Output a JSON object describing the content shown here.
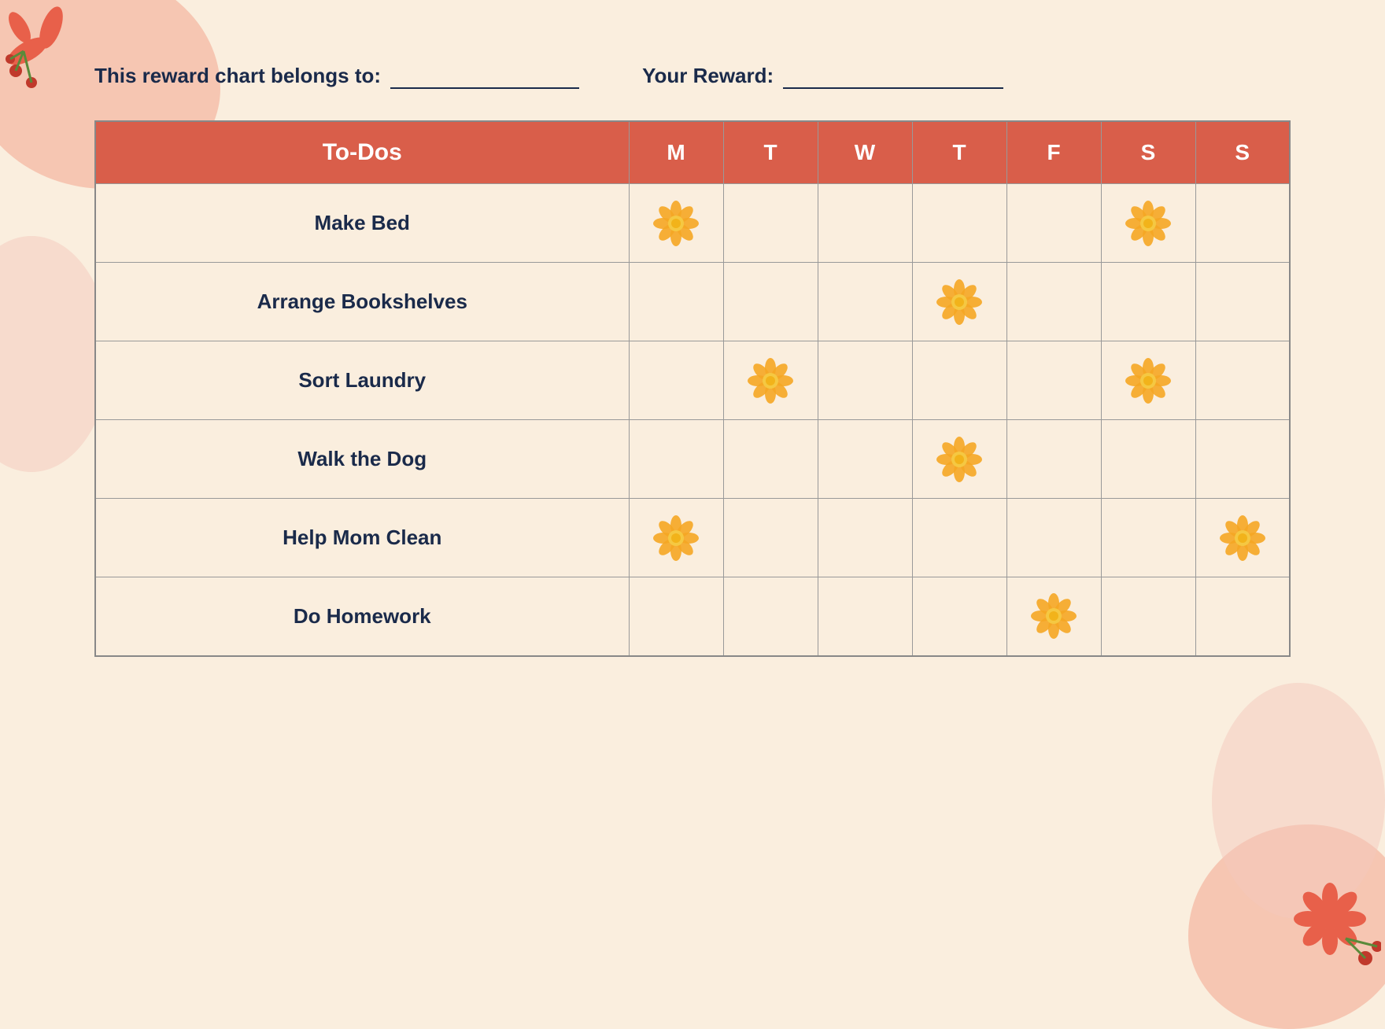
{
  "background_color": "#faeede",
  "header": {
    "belongs_label": "This reward chart belongs to:",
    "reward_label": "Your Reward:"
  },
  "table": {
    "col_header": "To-Dos",
    "days": [
      "M",
      "T",
      "W",
      "T",
      "F",
      "S",
      "S"
    ],
    "rows": [
      {
        "task": "Make Bed",
        "stars": [
          true,
          false,
          false,
          false,
          false,
          true,
          false
        ]
      },
      {
        "task": "Arrange Bookshelves",
        "stars": [
          false,
          false,
          false,
          true,
          false,
          false,
          false
        ]
      },
      {
        "task": "Sort Laundry",
        "stars": [
          false,
          true,
          false,
          false,
          false,
          true,
          false
        ]
      },
      {
        "task": "Walk the Dog",
        "stars": [
          false,
          false,
          false,
          true,
          false,
          false,
          false
        ]
      },
      {
        "task": "Help Mom Clean",
        "stars": [
          true,
          false,
          false,
          false,
          false,
          false,
          true
        ]
      },
      {
        "task": "Do Homework",
        "stars": [
          false,
          false,
          false,
          false,
          true,
          false,
          false
        ]
      }
    ]
  },
  "colors": {
    "header_bg": "#d95e4a",
    "text_dark": "#1a2a4a",
    "bg": "#faeede",
    "flower_orange": "#f5a623",
    "flower_center": "#f5c842"
  }
}
